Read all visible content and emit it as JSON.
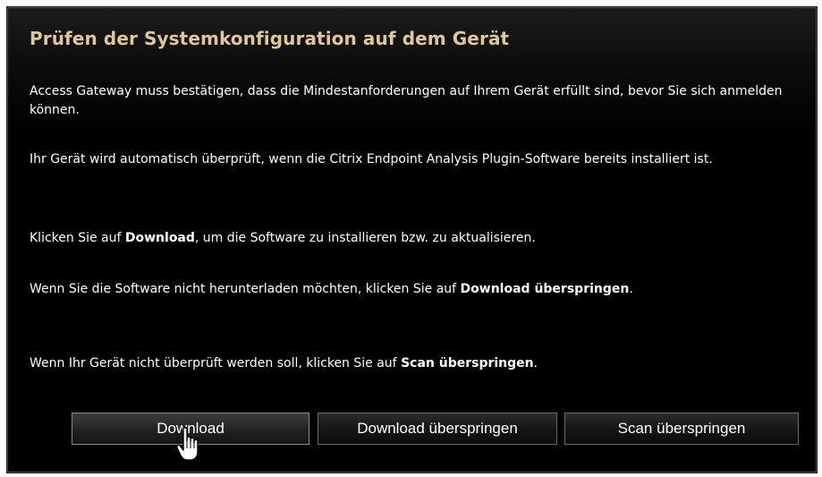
{
  "dialog": {
    "title": "Prüfen der Systemkonfiguration auf dem Gerät",
    "paragraph1": "Access Gateway muss bestätigen, dass die Mindestanforderungen auf Ihrem Gerät erfüllt sind, bevor Sie sich anmelden können.",
    "paragraph2": "Ihr Gerät wird automatisch überprüft, wenn die Citrix Endpoint Analysis Plugin-Software bereits installiert ist.",
    "paragraph3": {
      "before": "Klicken Sie auf ",
      "bold": "Download",
      "after": ", um die Software zu installieren bzw. zu aktualisieren."
    },
    "paragraph4": {
      "before": "Wenn Sie die Software nicht herunterladen möchten, klicken Sie auf ",
      "bold": "Download überspringen",
      "after": "."
    },
    "paragraph5": {
      "before": "Wenn Ihr Gerät nicht überprüft werden soll, klicken Sie auf ",
      "bold": "Scan überspringen",
      "after": "."
    }
  },
  "buttons": {
    "download": "Download",
    "skip_download": "Download überspringen",
    "skip_scan": "Scan überspringen"
  },
  "cursor": {
    "icon": "hand-pointer-icon"
  },
  "colors": {
    "title": "#e0c896",
    "background": "#000000",
    "text": "#ffffff"
  }
}
